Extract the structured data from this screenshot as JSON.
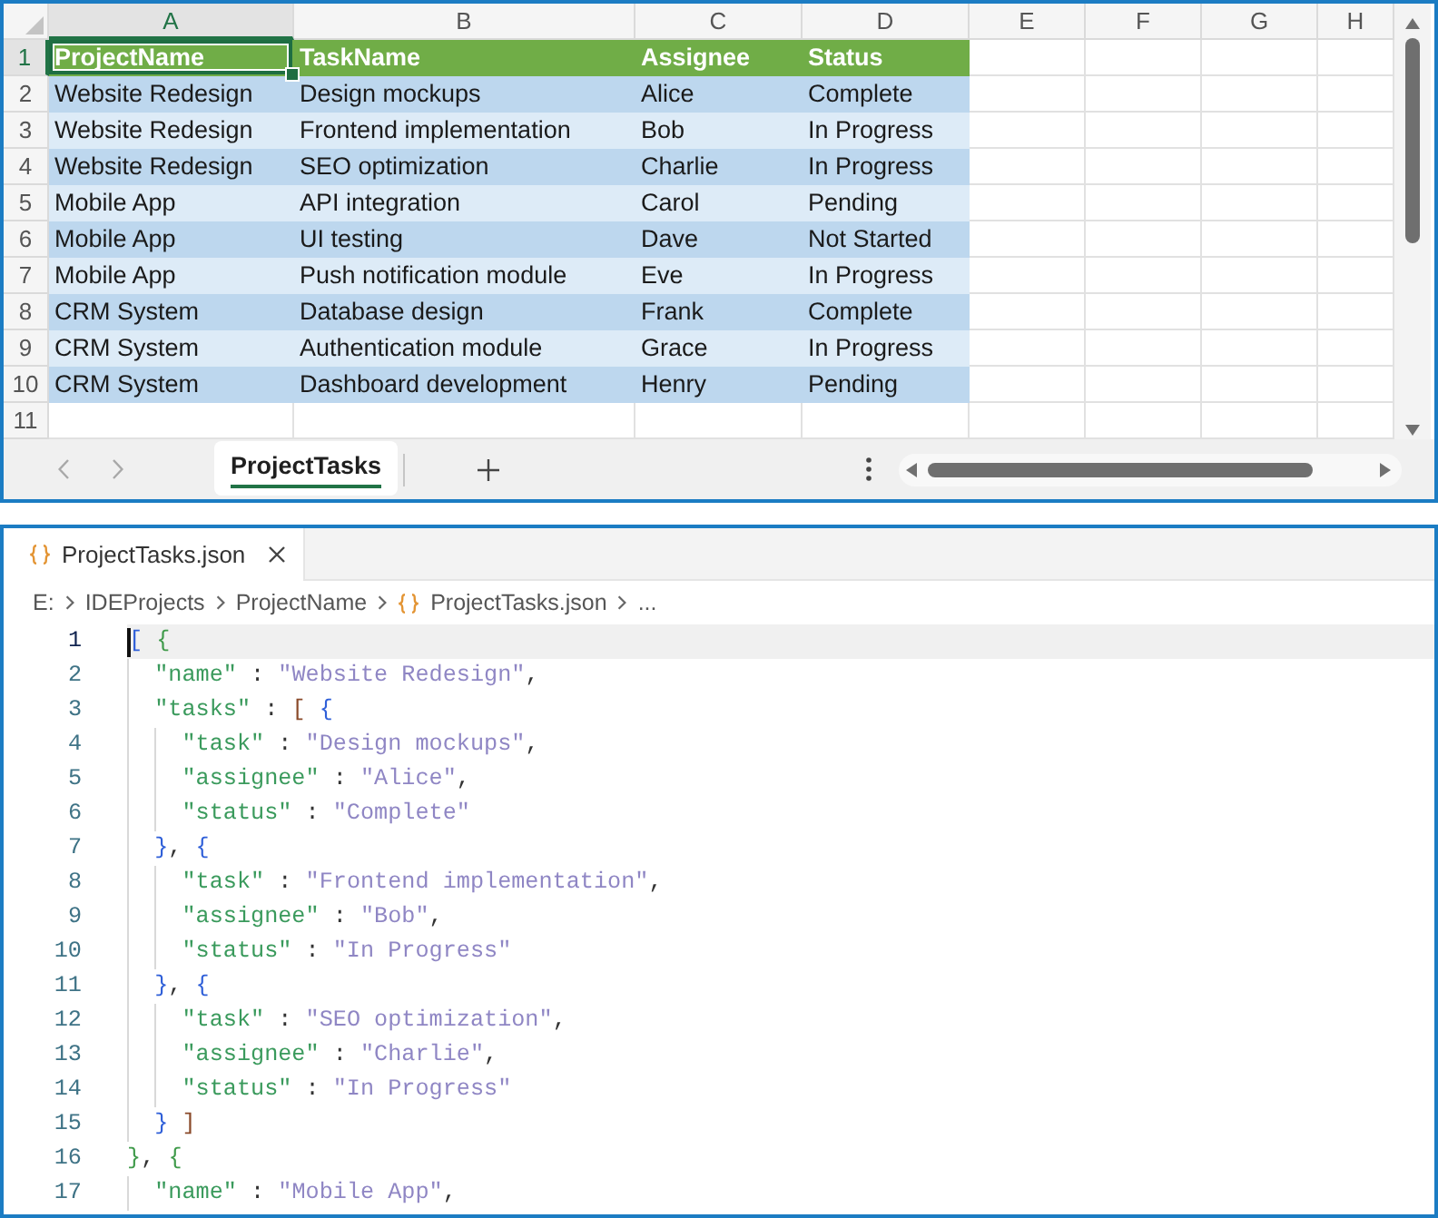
{
  "sheet": {
    "columns": [
      {
        "label": "A",
        "selected": true
      },
      {
        "label": "B",
        "selected": false
      },
      {
        "label": "C",
        "selected": false
      },
      {
        "label": "D",
        "selected": false
      },
      {
        "label": "E",
        "selected": false
      },
      {
        "label": "F",
        "selected": false
      },
      {
        "label": "G",
        "selected": false
      },
      {
        "label": "H",
        "selected": false
      }
    ],
    "rows": [
      {
        "number": "1",
        "selected": true,
        "kind": "header",
        "cells": [
          "ProjectName",
          "TaskName",
          "Assignee",
          "Status"
        ]
      },
      {
        "number": "2",
        "selected": false,
        "kind": "dark",
        "cells": [
          "Website Redesign",
          "Design mockups",
          "Alice",
          "Complete"
        ]
      },
      {
        "number": "3",
        "selected": false,
        "kind": "light",
        "cells": [
          "Website Redesign",
          "Frontend implementation",
          "Bob",
          "In Progress"
        ]
      },
      {
        "number": "4",
        "selected": false,
        "kind": "dark",
        "cells": [
          "Website Redesign",
          "SEO optimization",
          "Charlie",
          "In Progress"
        ]
      },
      {
        "number": "5",
        "selected": false,
        "kind": "light",
        "cells": [
          "Mobile App",
          "API integration",
          "Carol",
          "Pending"
        ]
      },
      {
        "number": "6",
        "selected": false,
        "kind": "dark",
        "cells": [
          "Mobile App",
          "UI testing",
          "Dave",
          "Not Started"
        ]
      },
      {
        "number": "7",
        "selected": false,
        "kind": "light",
        "cells": [
          "Mobile App",
          "Push notification module",
          "Eve",
          "In Progress"
        ]
      },
      {
        "number": "8",
        "selected": false,
        "kind": "dark",
        "cells": [
          "CRM System",
          "Database design",
          "Frank",
          "Complete"
        ]
      },
      {
        "number": "9",
        "selected": false,
        "kind": "light",
        "cells": [
          "CRM System",
          "Authentication module",
          "Grace",
          "In Progress"
        ]
      },
      {
        "number": "10",
        "selected": false,
        "kind": "dark",
        "cells": [
          "CRM System",
          "Dashboard development",
          "Henry",
          "Pending"
        ]
      },
      {
        "number": "11",
        "selected": false,
        "kind": "blank"
      }
    ],
    "tabs": [
      {
        "label": "ProjectTasks",
        "selected": true
      }
    ]
  },
  "editor": {
    "tabs": [
      {
        "label": "ProjectTasks.json",
        "selected": true
      }
    ],
    "breadcrumb": [
      {
        "label": "E:",
        "kind": "folder"
      },
      {
        "label": "IDEProjects",
        "kind": "folder"
      },
      {
        "label": "ProjectName",
        "kind": "folder"
      },
      {
        "label": "ProjectTasks.json",
        "kind": "file"
      },
      {
        "label": "...",
        "kind": "more"
      }
    ],
    "lines": [
      {
        "number": "1",
        "text": "[ {",
        "active": true
      },
      {
        "number": "2",
        "text": "  \"name\" : \"Website Redesign\",",
        "active": false
      },
      {
        "number": "3",
        "text": "  \"tasks\" : [ {",
        "active": false
      },
      {
        "number": "4",
        "text": "    \"task\" : \"Design mockups\",",
        "active": false
      },
      {
        "number": "5",
        "text": "    \"assignee\" : \"Alice\",",
        "active": false
      },
      {
        "number": "6",
        "text": "    \"status\" : \"Complete\"",
        "active": false
      },
      {
        "number": "7",
        "text": "  }, {",
        "active": false
      },
      {
        "number": "8",
        "text": "    \"task\" : \"Frontend implementation\",",
        "active": false
      },
      {
        "number": "9",
        "text": "    \"assignee\" : \"Bob\",",
        "active": false
      },
      {
        "number": "10",
        "text": "    \"status\" : \"In Progress\"",
        "active": false
      },
      {
        "number": "11",
        "text": "  }, {",
        "active": false
      },
      {
        "number": "12",
        "text": "    \"task\" : \"SEO optimization\",",
        "active": false
      },
      {
        "number": "13",
        "text": "    \"assignee\" : \"Charlie\",",
        "active": false
      },
      {
        "number": "14",
        "text": "    \"status\" : \"In Progress\"",
        "active": false
      },
      {
        "number": "15",
        "text": "  } ]",
        "active": false
      },
      {
        "number": "16",
        "text": "}, {",
        "active": false
      },
      {
        "number": "17",
        "text": "  \"name\" : \"Mobile App\",",
        "active": false
      }
    ]
  }
}
